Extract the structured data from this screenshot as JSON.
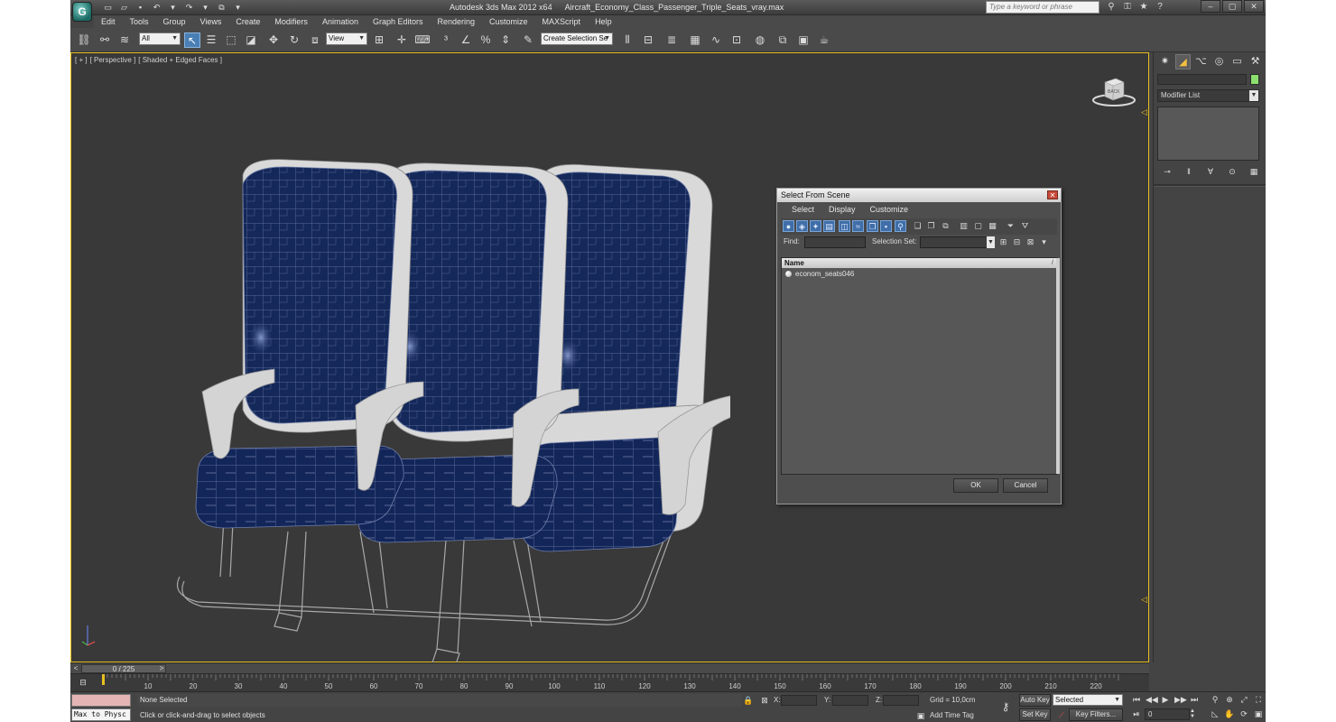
{
  "app": {
    "title": "Autodesk 3ds Max  2012 x64",
    "file": "Aircraft_Economy_Class_Passenger_Triple_Seats_vray.max",
    "logo_letter": "G",
    "search_placeholder": "Type a keyword or phrase"
  },
  "menu": [
    "Edit",
    "Tools",
    "Group",
    "Views",
    "Create",
    "Modifiers",
    "Animation",
    "Graph Editors",
    "Rendering",
    "Customize",
    "MAXScript",
    "Help"
  ],
  "toolbar": {
    "selection_filter": "All",
    "reference_coord": "View",
    "named_selection": "Create Selection Se"
  },
  "viewport": {
    "label_parts": [
      "[ + ]",
      "[ Perspective ]",
      "[ Shaded + Edged Faces ]"
    ],
    "viewcube_face": "BACK",
    "accent_color": "#e8c020",
    "seat_color": "#14285a",
    "frame_color": "#a9a9a9"
  },
  "dialog": {
    "title": "Select From Scene",
    "menu": [
      "Select",
      "Display",
      "Customize"
    ],
    "find_label": "Find:",
    "selection_set_label": "Selection Set:",
    "column_name": "Name",
    "objects": [
      "econom_seats046"
    ],
    "ok": "OK",
    "cancel": "Cancel"
  },
  "command_panel": {
    "modifier_list": "Modifier List",
    "object_color": "#8ce06e"
  },
  "timeline": {
    "position": "0 / 225",
    "current_frame": 0,
    "total_frames": 225,
    "tick_labels": [
      "10",
      "20",
      "30",
      "40",
      "50",
      "60",
      "70",
      "80",
      "90",
      "100",
      "110",
      "120",
      "130",
      "140",
      "150",
      "160",
      "170",
      "180",
      "190",
      "200",
      "210",
      "220"
    ]
  },
  "status": {
    "maxscript_text": "Max to Physc",
    "selection": "None Selected",
    "prompt": "Click or click-and-drag to select objects",
    "x_label": "X:",
    "y_label": "Y:",
    "z_label": "Z:",
    "grid": "Grid = 10,0cm",
    "add_time_tag": "Add Time Tag",
    "auto_key": "Auto Key",
    "set_key": "Set Key",
    "key_mode": "Selected",
    "key_filters": "Key Filters...",
    "frame": "0"
  }
}
